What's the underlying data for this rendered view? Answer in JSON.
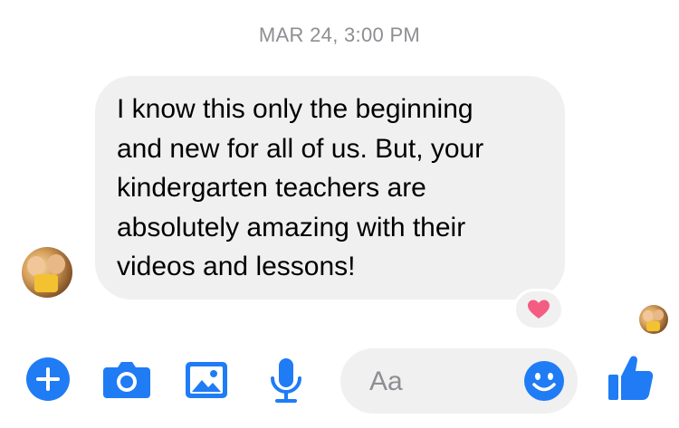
{
  "conversation": {
    "timestamp": "MAR 24, 3:00 PM",
    "message": {
      "lines": [
        "I know this only the beginning",
        "and new for all of us. But, your",
        "kindergarten teachers are",
        "absolutely amazing with their",
        "videos and lessons!"
      ],
      "reaction": "heart-icon"
    }
  },
  "composer": {
    "placeholder": "Aa"
  },
  "toolbar": {
    "icons": [
      "add-icon",
      "camera-icon",
      "photo-icon",
      "microphone-icon",
      "emoji-icon",
      "thumbs-up-icon"
    ]
  },
  "colors": {
    "accent": "#1f7cf4",
    "bubble": "#f0f0f0",
    "heart": "#f45c82",
    "timestamp": "#8e8e93"
  }
}
